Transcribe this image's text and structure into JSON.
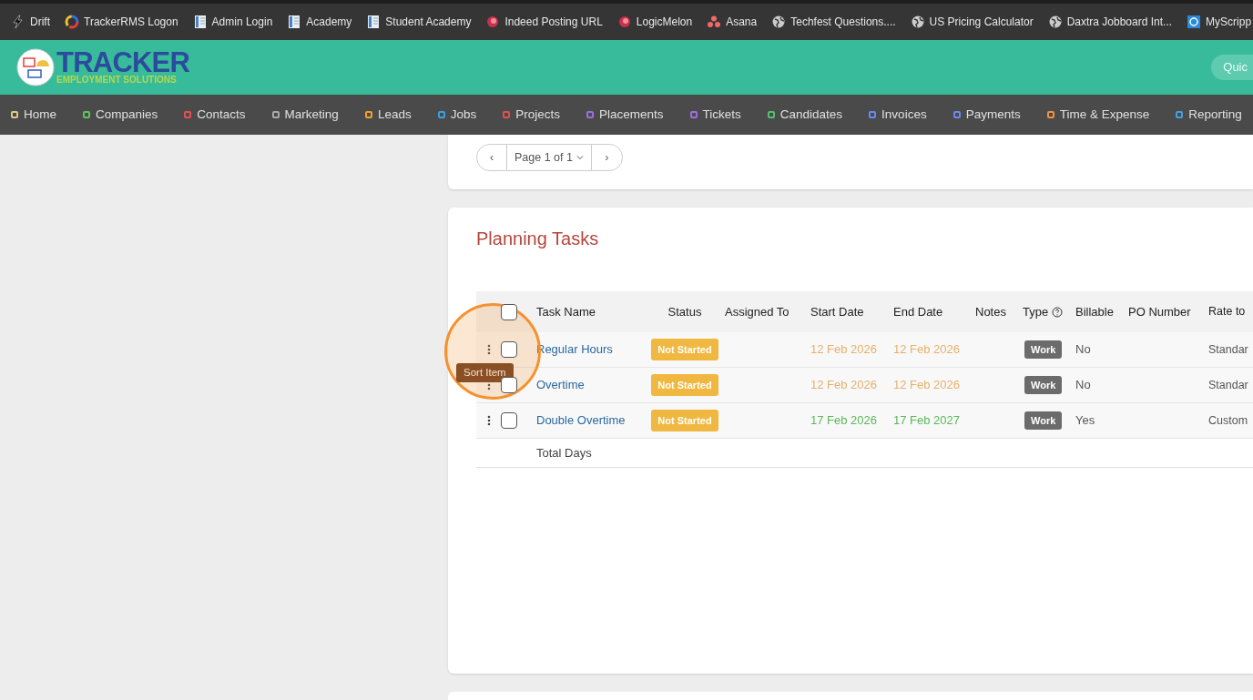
{
  "bookmarks": [
    {
      "label": "Drift",
      "kind": "bolt"
    },
    {
      "label": "TrackerRMS Logon",
      "kind": "ring"
    },
    {
      "label": "Admin Login",
      "kind": "doc"
    },
    {
      "label": "Academy",
      "kind": "doc"
    },
    {
      "label": "Student Academy",
      "kind": "doc"
    },
    {
      "label": "Indeed Posting URL",
      "kind": "melon"
    },
    {
      "label": "LogicMelon",
      "kind": "melon"
    },
    {
      "label": "Asana",
      "kind": "dots"
    },
    {
      "label": "Techfest Questions....",
      "kind": "globe"
    },
    {
      "label": "US Pricing Calculator",
      "kind": "globe"
    },
    {
      "label": "Daxtra Jobboard Int...",
      "kind": "globe"
    },
    {
      "label": "MyScripp",
      "kind": "square"
    }
  ],
  "logo": {
    "title": "TRACKER",
    "subtitle": "EMPLOYMENT SOLUTIONS"
  },
  "quick_button": "Quic",
  "nav": [
    {
      "label": "Home",
      "color": "#d9c98a"
    },
    {
      "label": "Companies",
      "color": "#5cc35c"
    },
    {
      "label": "Contacts",
      "color": "#e55050"
    },
    {
      "label": "Marketing",
      "color": "#aaaaaa"
    },
    {
      "label": "Leads",
      "color": "#f0a030"
    },
    {
      "label": "Jobs",
      "color": "#3aa0e0"
    },
    {
      "label": "Projects",
      "color": "#e05050"
    },
    {
      "label": "Placements",
      "color": "#9a70e0"
    },
    {
      "label": "Tickets",
      "color": "#9a70e0"
    },
    {
      "label": "Candidates",
      "color": "#50c070"
    },
    {
      "label": "Invoices",
      "color": "#6a8af0"
    },
    {
      "label": "Payments",
      "color": "#6a8af0"
    },
    {
      "label": "Time & Expense",
      "color": "#f09040"
    },
    {
      "label": "Reporting",
      "color": "#40a0e0"
    }
  ],
  "pager": {
    "prev": "‹",
    "page": "Page 1 of 1",
    "next": "›"
  },
  "planning": {
    "title": "Planning Tasks",
    "columns": [
      "Task Name",
      "Status",
      "Assigned To",
      "Start Date",
      "End Date",
      "Notes",
      "Type",
      "Billable",
      "PO Number",
      "Rate to"
    ],
    "select_all_checked": false,
    "rows": [
      {
        "checked": false,
        "name": "Regular Hours",
        "status": "Not Started",
        "start": "12 Feb 2026",
        "end": "12 Feb 2026",
        "color": "#e8b06a",
        "type": "Work",
        "billable": "No",
        "rate": "Standar"
      },
      {
        "checked": false,
        "name": "Overtime",
        "status": "Not Started",
        "start": "12 Feb 2026",
        "end": "12 Feb 2026",
        "color": "#e8b06a",
        "type": "Work",
        "billable": "No",
        "rate": "Standar"
      },
      {
        "checked": false,
        "name": "Double Overtime",
        "status": "Not Started",
        "start": "17 Feb 2026",
        "end": "17 Feb 2027",
        "color": "#5cb85c",
        "type": "Work",
        "billable": "Yes",
        "rate": "Custom"
      }
    ],
    "total_label": "Total Days"
  },
  "tooltip": "Sort Item"
}
